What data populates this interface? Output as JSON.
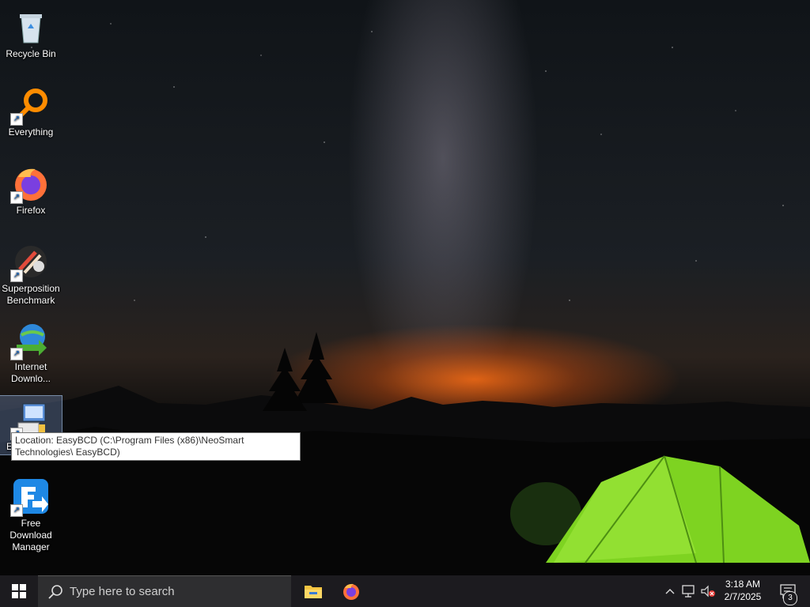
{
  "desktop": {
    "icons": [
      {
        "label": "Recycle Bin",
        "icon": "recycle-bin-icon"
      },
      {
        "label": "Everything",
        "icon": "everything-search-icon"
      },
      {
        "label": "Firefox",
        "icon": "firefox-icon"
      },
      {
        "label": "Superposition Benchmark",
        "label_lines": [
          "Superposition",
          "Benchmark"
        ],
        "icon": "superposition-benchmark-icon"
      },
      {
        "label": "Internet Downlo...",
        "label_lines": [
          "Internet",
          "Downlo..."
        ],
        "icon": "internet-download-manager-icon"
      },
      {
        "label": "E",
        "icon": "easybcd-icon",
        "selected": true
      },
      {
        "label": "Free Download Manager",
        "label_lines": [
          "Free",
          "Download",
          "Manager"
        ],
        "icon": "free-download-manager-icon"
      }
    ],
    "tooltip": {
      "text": "Location: EasyBCD (C:\\Program Files (x86)\\NeoSmart Technologies\\ EasyBCD)"
    }
  },
  "taskbar": {
    "start_icon": "windows-logo-icon",
    "search": {
      "placeholder": "Type here to search",
      "icon": "search-icon"
    },
    "pinned": [
      {
        "name": "File Explorer",
        "icon": "file-explorer-icon"
      },
      {
        "name": "Firefox",
        "icon": "firefox-icon"
      }
    ],
    "tray": {
      "icons": [
        "chevron-up-icon",
        "network-icon",
        "volume-muted-icon"
      ],
      "time": "3:18 AM",
      "date": "2/7/2025",
      "notification_count": "3"
    }
  },
  "colors": {
    "taskbar": "#1c1b1f",
    "search_box": "#2e2e30",
    "tent_green": "#7ed321",
    "horizon_orange": "#ff6a14"
  }
}
